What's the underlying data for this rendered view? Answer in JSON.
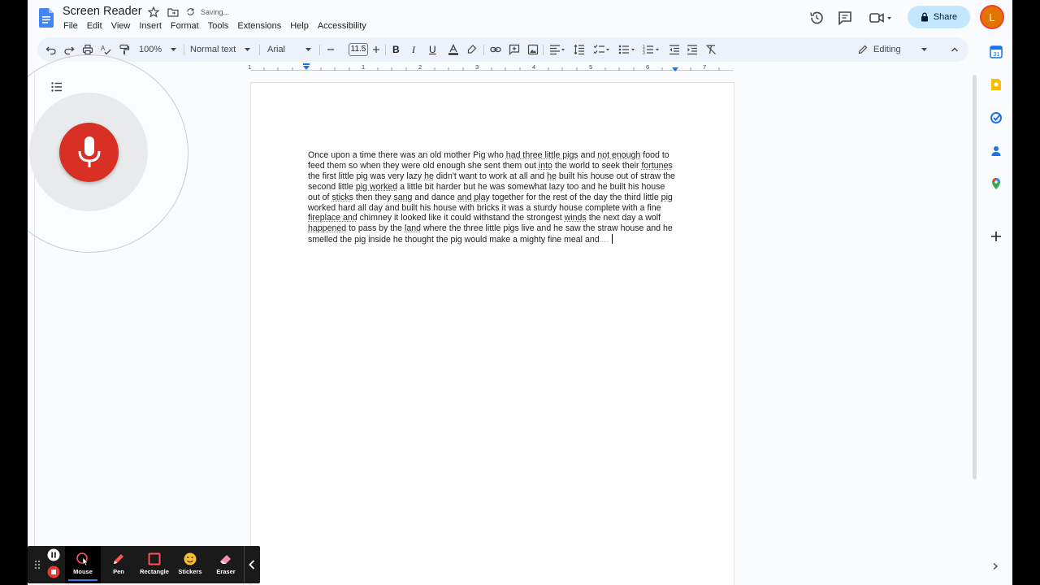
{
  "doc": {
    "title": "Screen Reader",
    "save_status": "Saving..."
  },
  "menu": [
    "File",
    "Edit",
    "View",
    "Insert",
    "Format",
    "Tools",
    "Extensions",
    "Help",
    "Accessibility"
  ],
  "header": {
    "share_label": "Share",
    "avatar_initial": "L"
  },
  "toolbar": {
    "zoom": "100%",
    "style": "Normal text",
    "font": "Arial",
    "font_size": "11.5",
    "mode": "Editing"
  },
  "ruler": [
    "1",
    "1",
    "2",
    "3",
    "4",
    "5",
    "6",
    "7"
  ],
  "document": {
    "paragraph_segments": [
      {
        "t": "Once upon a time there was an old mother Pig who "
      },
      {
        "t": "had three little pigs",
        "sq": true
      },
      {
        "t": " and "
      },
      {
        "t": "not enough",
        "sq": true
      },
      {
        "t": " food to feed them so when they were old enough she sent them out "
      },
      {
        "t": "into",
        "sq": true
      },
      {
        "t": " the world to seek their "
      },
      {
        "t": "fortunes",
        "sq": true
      },
      {
        "t": " the first little pig was very lazy "
      },
      {
        "t": "he",
        "sq": true
      },
      {
        "t": " didn't want to work at all and "
      },
      {
        "t": "he",
        "sq": true
      },
      {
        "t": " built his house out of straw the second little "
      },
      {
        "t": "pig worked",
        "sq": true
      },
      {
        "t": " a little bit harder but he was somewhat lazy too and he built his house out of "
      },
      {
        "t": "sticks",
        "sq": true
      },
      {
        "t": " then they "
      },
      {
        "t": "sang",
        "sq": true
      },
      {
        "t": " and dance "
      },
      {
        "t": "and play",
        "sq": true
      },
      {
        "t": " together for the rest of the day the third little "
      },
      {
        "t": "pig",
        "sq": true
      },
      {
        "t": " worked hard all day and built his house with bricks it was a sturdy house complete with a fine "
      },
      {
        "t": "fireplace and",
        "sq": true
      },
      {
        "t": " chimney it looked like it could withstand the strongest "
      },
      {
        "t": "winds",
        "sq": true
      },
      {
        "t": " the next day a wolf "
      },
      {
        "t": "happened",
        "sq": true
      },
      {
        "t": " to pass by the "
      },
      {
        "t": "land",
        "sq": true
      },
      {
        "t": " where the three little pigs live and he saw the straw house and he smelled the pig inside he thought the pig would make a mighty fine meal and"
      },
      {
        "t": "....",
        "grey": true
      }
    ]
  },
  "annotation_bar": {
    "tools": [
      "Mouse",
      "Pen",
      "Rectangle",
      "Stickers",
      "Eraser"
    ],
    "active_tool": "Mouse"
  },
  "colors": {
    "accent": "#c2e7ff",
    "mic_red": "#d93025",
    "avatar": "#e37400",
    "share_text": "#001d35"
  }
}
